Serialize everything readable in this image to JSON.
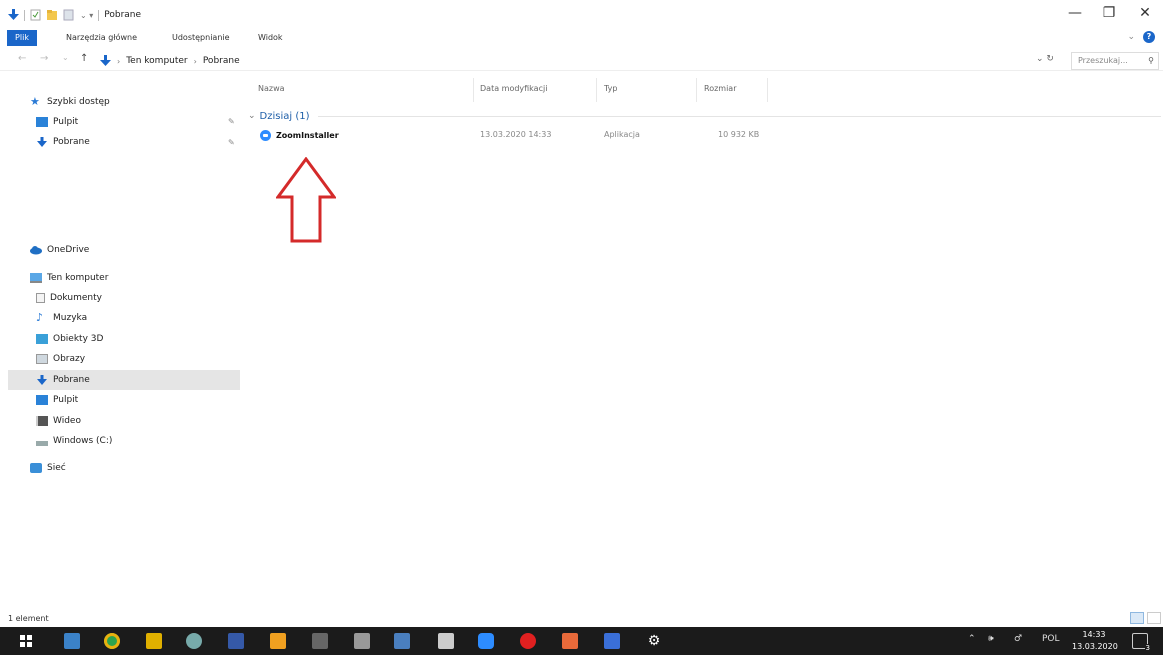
{
  "window": {
    "title": "Pobrane",
    "minimize_glyph": "—",
    "restore_glyph": "❐",
    "close_glyph": "✕"
  },
  "ribbon": {
    "tabs": [
      "Plik",
      "Narzędzia główne",
      "Udostępnianie",
      "Widok"
    ],
    "collapse_glyph": "⌄",
    "help_glyph": "?"
  },
  "address_bar": {
    "path": [
      "Ten komputer",
      "Pobrane"
    ],
    "search_placeholder": "Przeszukaj...",
    "refresh_glyph": "↻",
    "dropdown_glyph": "⌄"
  },
  "sidebar": {
    "quick_access": "Szybki dostęp",
    "quick_items": [
      {
        "label": "Pulpit",
        "icon": "desktop-icon"
      },
      {
        "label": "Pobrane",
        "icon": "download-icon"
      }
    ],
    "onedrive": "OneDrive",
    "this_pc": "Ten komputer",
    "pc_items": [
      {
        "label": "Dokumenty",
        "icon": "document-icon"
      },
      {
        "label": "Muzyka",
        "icon": "music-icon"
      },
      {
        "label": "Obiekty 3D",
        "icon": "cube-icon"
      },
      {
        "label": "Obrazy",
        "icon": "image-icon"
      },
      {
        "label": "Pobrane",
        "icon": "download-icon",
        "selected": true
      },
      {
        "label": "Pulpit",
        "icon": "desktop-icon"
      },
      {
        "label": "Wideo",
        "icon": "video-icon"
      },
      {
        "label": "Windows (C:)",
        "icon": "drive-icon"
      }
    ],
    "network": "Sieć"
  },
  "file_list": {
    "columns": [
      "Nazwa",
      "Data modyfikacji",
      "Typ",
      "Rozmiar"
    ],
    "group_label": "Dzisiaj (1)",
    "files": [
      {
        "name": "ZoomInstaller",
        "modified": "13.03.2020 14:33",
        "type": "Aplikacja",
        "size": "10 932 KB"
      }
    ]
  },
  "status": {
    "item_count": "1 element"
  },
  "taskbar": {
    "tray_lang": "POL",
    "time": "14:33",
    "date": "13.03.2020",
    "notification_count": "3"
  },
  "colors": {
    "accent": "#1a66c9",
    "annotation_arrow": "#d42a2a",
    "taskbar": "#1b1b1b",
    "selection": "#e5e5e5"
  }
}
